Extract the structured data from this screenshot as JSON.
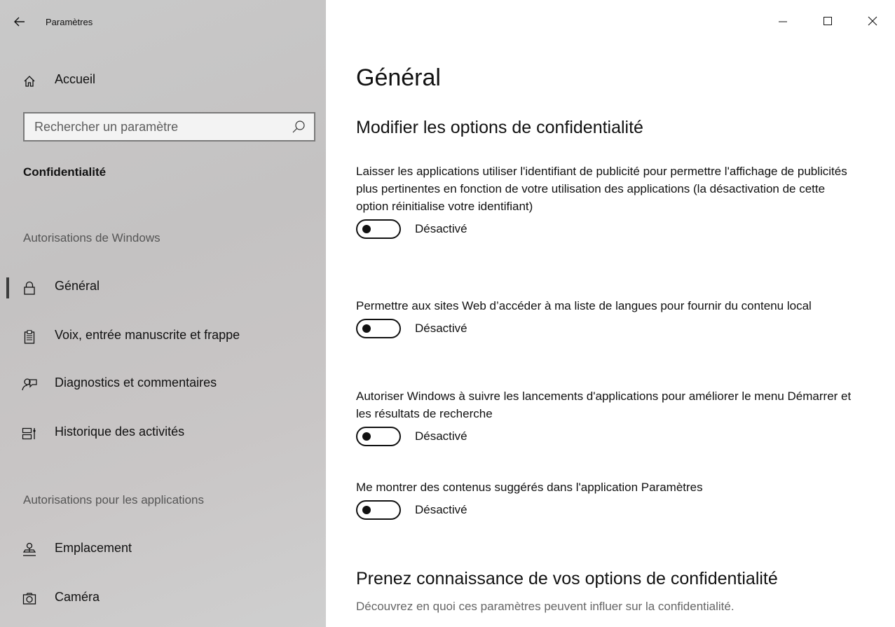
{
  "window": {
    "title": "Paramètres",
    "controls": [
      "minimize",
      "maximize",
      "close"
    ]
  },
  "sidebar": {
    "home_label": "Accueil",
    "search_placeholder": "Rechercher un paramètre",
    "section_title": "Confidentialité",
    "group1_header": "Autorisations de Windows",
    "group1_items": [
      {
        "label": "Général",
        "icon": "lock-icon",
        "active": true
      },
      {
        "label": "Voix, entrée manuscrite et frappe",
        "icon": "clipboard-icon",
        "active": false
      },
      {
        "label": "Diagnostics et commentaires",
        "icon": "feedback-icon",
        "active": false
      },
      {
        "label": "Historique des activités",
        "icon": "timeline-icon",
        "active": false
      }
    ],
    "group2_header": "Autorisations pour les applications",
    "group2_items": [
      {
        "label": "Emplacement",
        "icon": "location-icon"
      },
      {
        "label": "Caméra",
        "icon": "camera-icon"
      }
    ]
  },
  "main": {
    "title": "Général",
    "section1_heading": "Modifier les options de confidentialité",
    "options": [
      {
        "text": "Laisser les applications utiliser l'identifiant de publicité pour permettre l'affichage de publicités plus pertinentes en fonction de votre utilisation des applications (la désactivation de cette option réinitialise votre identifiant)",
        "state": "Désactivé",
        "on": false
      },
      {
        "text": "Permettre aux sites Web d’accéder à ma liste de langues pour fournir du contenu local",
        "state": "Désactivé",
        "on": false
      },
      {
        "text": "Autoriser Windows à suivre les lancements d'applications pour améliorer le menu Démarrer et les résultats de recherche",
        "state": "Désactivé",
        "on": false
      },
      {
        "text": "Me montrer des contenus suggérés dans l'application Paramètres",
        "state": "Désactivé",
        "on": false
      }
    ],
    "section2_heading": "Prenez connaissance de vos options de confidentialité",
    "section2_description": "Découvrez en quoi ces paramètres peuvent influer sur la confidentialité."
  }
}
